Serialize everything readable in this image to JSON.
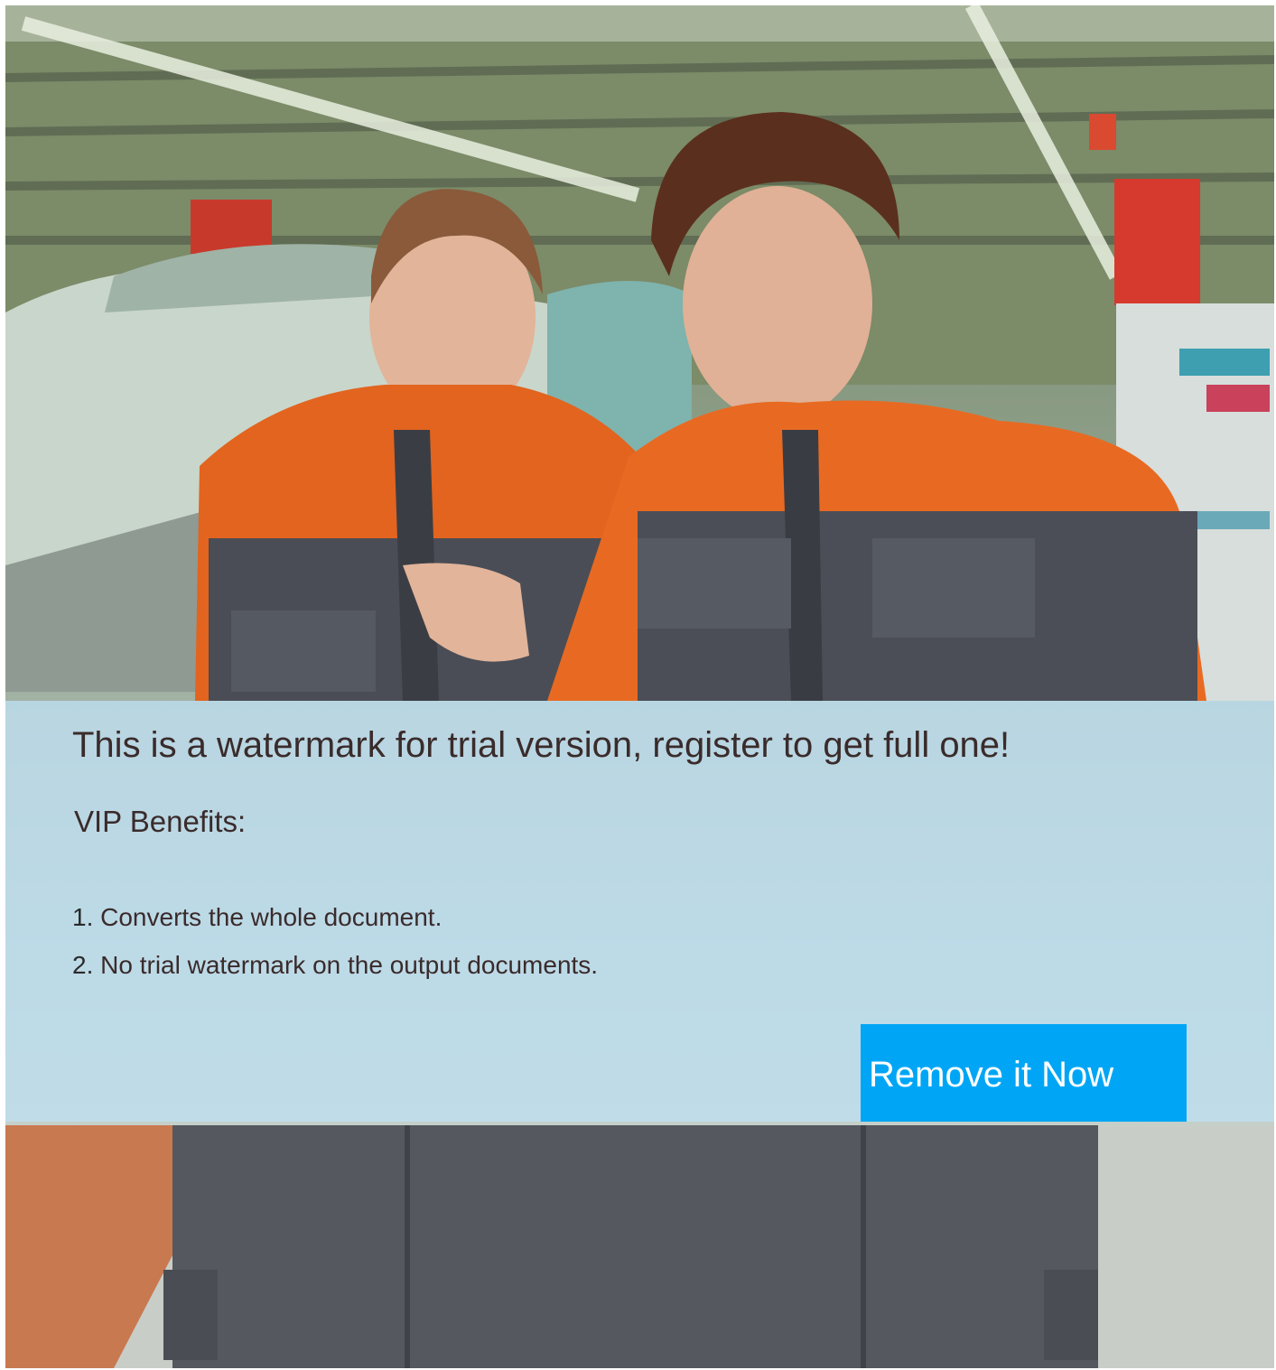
{
  "watermark": {
    "title": "This is a watermark for trial version, register to get full one!",
    "vip_heading": "VIP Benefits:",
    "benefits": [
      {
        "number": "1.",
        "text": "Converts the whole document."
      },
      {
        "number": "2.",
        "text": "No trial watermark on the output documents."
      }
    ],
    "button_label": "Remove it Now"
  },
  "colors": {
    "overlay": "#bedef0",
    "button": "#00a6f5",
    "button_text": "#ffffff",
    "text": "#3a2b2b"
  }
}
